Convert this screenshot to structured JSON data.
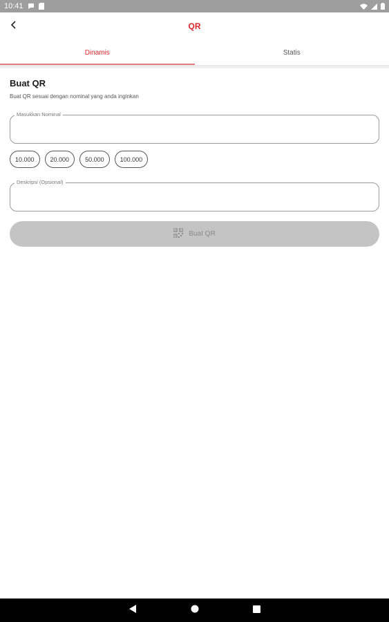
{
  "status_bar": {
    "time": "10:41"
  },
  "app_bar": {
    "title": "QR"
  },
  "tabs": [
    {
      "label": "Dinamis",
      "active": true
    },
    {
      "label": "Statis",
      "active": false
    }
  ],
  "form": {
    "title": "Buat QR",
    "description": "Buat QR sesuai dengan nominal yang anda inginkan",
    "nominal_label": "Masukkan Nominal",
    "nominal_value": "",
    "quick_amounts": [
      "10.000",
      "20.000",
      "50.000",
      "100.000"
    ],
    "desc_label": "Deskripsi (Opsional)",
    "desc_value": "",
    "submit_label": "Buat QR"
  },
  "colors": {
    "accent": "#d9262a",
    "button_disabled": "#c4c4c4",
    "status_bar": "#9e9e9e",
    "nav_bar": "#000000"
  },
  "icons": {
    "back": "arrow-back-icon",
    "submit": "qr-code-icon",
    "nav": [
      "nav-back-icon",
      "nav-home-icon",
      "nav-recents-icon"
    ]
  }
}
